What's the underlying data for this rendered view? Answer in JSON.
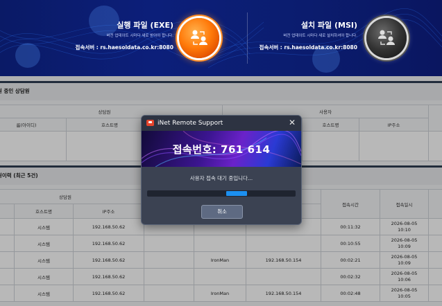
{
  "hero": {
    "exe": {
      "title": "실행 파일 (EXE)",
      "desc": "버전 업데이트 시마다 새로 받아야 합니다.",
      "server": "접속서버 : rs.haesoldata.co.kr:8080"
    },
    "msi": {
      "title": "설치 파일 (MSI)",
      "desc": "버전 업데이트 시마다 새로 설치하셔야 합니다.",
      "server": "접속서버 : rs.haesoldata.co.kr:8080"
    },
    "colors": {
      "banner": "#0c1f7a",
      "exe_button": "#ff7a0a",
      "msi_button": "#333333"
    }
  },
  "section1": {
    "title": "원 중인 상담원",
    "group_agent": "상담원",
    "group_user": "사용자",
    "col_id": "름(아이디)",
    "col_host": "호스트명",
    "col_user_host": "호스트명",
    "col_user_ip": "IP주소"
  },
  "section2": {
    "title": "원이력 (최근 5건)",
    "group_agent": "상담원",
    "col_host": "호스트명",
    "col_ip": "IP주소",
    "col_time": "접속시간",
    "col_date": "접속일시",
    "rows": [
      {
        "host": "시스템",
        "ip": "192.168.50.62",
        "user_host": "",
        "user_ip": "",
        "time": "00:11:32",
        "date": "2026-08-05",
        "clock": "10:10"
      },
      {
        "host": "시스템",
        "ip": "192.168.50.62",
        "user_host": "",
        "user_ip": "",
        "time": "00:10:55",
        "date": "2026-08-05",
        "clock": "10:09"
      },
      {
        "host": "시스템",
        "ip": "192.168.50.62",
        "user_host": "IronMan",
        "user_ip": "192.168.50.154",
        "time": "00:02:21",
        "date": "2026-08-05",
        "clock": "10:09"
      },
      {
        "host": "시스템",
        "ip": "192.168.50.62",
        "user_host": "",
        "user_ip": "",
        "time": "00:02:32",
        "date": "2026-08-05",
        "clock": "10:06"
      },
      {
        "host": "시스템",
        "ip": "192.168.50.62",
        "user_host": "IronMan",
        "user_ip": "192.168.50.154",
        "time": "00:02:48",
        "date": "2026-08-05",
        "clock": "10:05"
      }
    ]
  },
  "modal": {
    "title": "iNet Remote Support",
    "close_icon": "close-icon",
    "connection_label": "접속번호: 761 614",
    "waiting_text": "사용자 접속 대기 중입니다...",
    "cancel_label": "취소",
    "accent": "#1c8ff0"
  }
}
